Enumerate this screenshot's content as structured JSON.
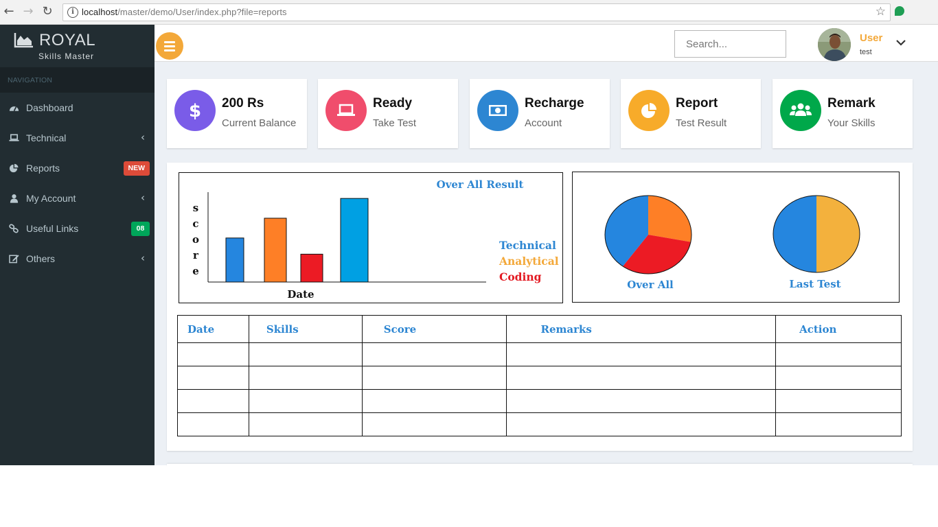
{
  "browser": {
    "url_host": "localhost",
    "url_path": "/master/demo/User/index.php?file=reports"
  },
  "brand": {
    "title": "ROYAL",
    "subtitle": "Skills Master"
  },
  "sidebar": {
    "header": "NAVIGATION",
    "items": [
      {
        "label": "Dashboard",
        "icon": "dashboard-icon"
      },
      {
        "label": "Technical",
        "icon": "laptop-icon",
        "chevron": "‹"
      },
      {
        "label": "Reports",
        "icon": "pie-chart-icon",
        "badge": "NEW"
      },
      {
        "label": "My Account",
        "icon": "user-icon",
        "chevron": "‹"
      },
      {
        "label": "Useful Links",
        "icon": "link-icon",
        "badge": "08"
      },
      {
        "label": "Others",
        "icon": "edit-icon",
        "chevron": "‹"
      }
    ]
  },
  "topbar": {
    "search_placeholder": "Search...",
    "user_name": "User",
    "user_sub": "test"
  },
  "info_boxes": [
    {
      "value": "200 Rs",
      "label": "Current Balance",
      "color": "#7a5ce8",
      "icon": "dollar-icon",
      "glyph": "$"
    },
    {
      "value": "Ready",
      "label": "Take Test",
      "color": "#f04d6c",
      "icon": "laptop-icon"
    },
    {
      "value": "Recharge",
      "label": "Account",
      "color": "#2d86d2",
      "icon": "money-icon"
    },
    {
      "value": "Report",
      "label": "Test Result",
      "color": "#f7ab2a",
      "icon": "pie-chart-icon"
    },
    {
      "value": "Remark",
      "label": "Your Skills",
      "color": "#00a84a",
      "icon": "users-icon"
    }
  ],
  "bar_chart_text": {
    "title": "Over All Result",
    "ylabel": "score",
    "xlabel": "Date",
    "legend": [
      {
        "label": "Technical",
        "color": "#2d86d2"
      },
      {
        "label": "Analytical",
        "color": "#f3a839"
      },
      {
        "label": "Coding",
        "color": "#e31b23"
      }
    ]
  },
  "chart_data": [
    {
      "type": "bar",
      "title": "Over All Result",
      "xlabel": "Date",
      "ylabel": "score",
      "categories": [
        "",
        "",
        "",
        ""
      ],
      "values": [
        49,
        71,
        31,
        93
      ],
      "ylim": [
        0,
        100
      ],
      "colors": [
        "#2586df",
        "#fe7f26",
        "#ec1b24",
        "#00a0e3"
      ],
      "grid": false
    },
    {
      "type": "pie",
      "title": "Over All",
      "values": [
        28,
        32,
        40
      ],
      "colors": [
        "#fe7f26",
        "#ec1b24",
        "#2586df"
      ]
    },
    {
      "type": "pie",
      "title": "Last Test",
      "values": [
        50,
        50
      ],
      "colors": [
        "#f3b13d",
        "#2586df"
      ]
    }
  ],
  "table": {
    "headers": [
      "Date",
      "Skills",
      "Score",
      "Remarks",
      "Action"
    ],
    "rows": [
      [
        "",
        "",
        "",
        "",
        ""
      ],
      [
        "",
        "",
        "",
        "",
        ""
      ],
      [
        "",
        "",
        "",
        "",
        ""
      ],
      [
        "",
        "",
        "",
        "",
        ""
      ]
    ]
  }
}
